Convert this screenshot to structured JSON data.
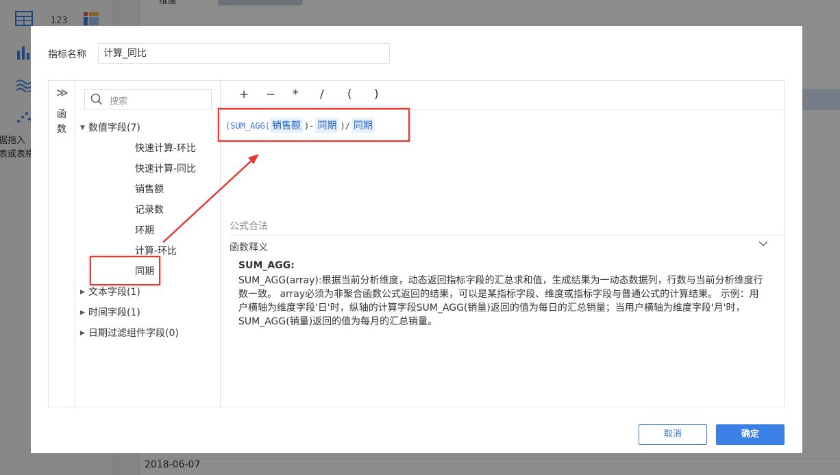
{
  "background": {
    "header_label": "维度",
    "left_text_1": "据拖入",
    "left_text_2": "表或表格",
    "date_row": "2018-06-07"
  },
  "dialog": {
    "name_label": "指标名称",
    "name_value": "计算_同比",
    "vertical_tab": {
      "chevron": "≫",
      "label": "函数"
    },
    "search": {
      "placeholder": "搜索"
    },
    "tree": {
      "groups": [
        {
          "label": "数值字段(7)",
          "expanded": true
        },
        {
          "label": "文本字段(1)",
          "expanded": false
        },
        {
          "label": "时间字段(1)",
          "expanded": false
        },
        {
          "label": "日期过滤组件字段(0)",
          "expanded": false
        }
      ],
      "numeric_items": [
        "快速计算-环比",
        "快速计算-同比",
        "销售额",
        "记录数",
        "环期",
        "计算-环比",
        "同期"
      ]
    },
    "operators": [
      "+",
      "−",
      "*",
      "/",
      "(",
      ")"
    ],
    "formula": {
      "open": "(SUM_AGG(",
      "field1": "销售额",
      "mid": ")-",
      "field2": "同期",
      "close": ")/",
      "field3": "同期"
    },
    "valid_text": "公式合法",
    "explain_header": "函数释义",
    "function_name": "SUM_AGG:",
    "function_desc": "SUM_AGG(array):根据当前分析维度，动态返回指标字段的汇总求和值，生成结果为一动态数据列，行数与当前分析维度行数一致。 array必须为非聚合函数公式返回的结果，可以是某指标字段、维度或指标字段与普通公式的计算结果。 示例：用户横轴为维度字段'日'时，纵轴的计算字段SUM_AGG(销量)返回的值为每日的汇总销量；当用户横轴为维度字段'月'时，SUM_AGG(销量)返回的值为每月的汇总销量。",
    "buttons": {
      "cancel": "取消",
      "ok": "确定"
    }
  },
  "colors": {
    "accent": "#3a80e6",
    "highlight": "#e53935",
    "field_chip_bg": "#e8f0fb"
  }
}
